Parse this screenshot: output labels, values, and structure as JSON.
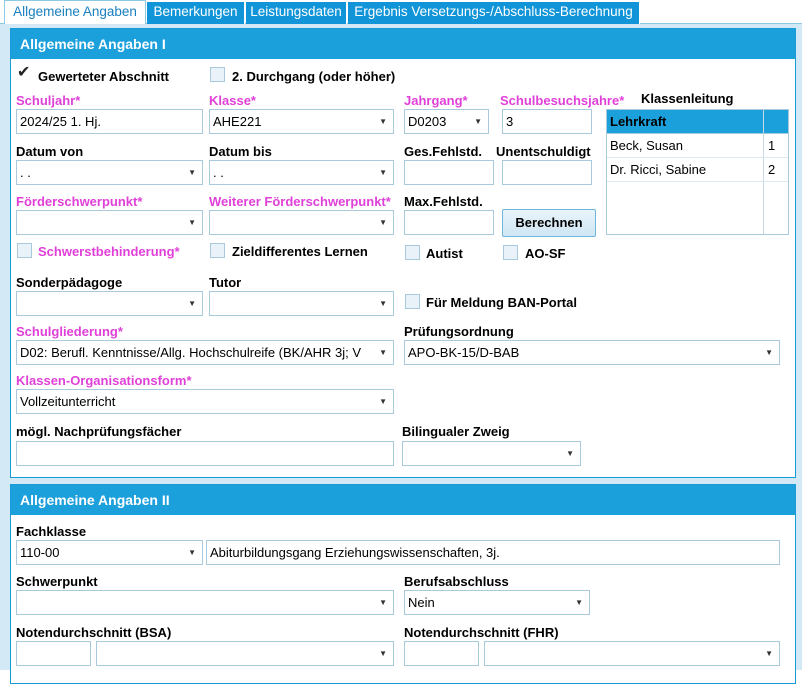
{
  "tabs": [
    "Allgemeine Angaben",
    "Bemerkungen",
    "Leistungsdaten",
    "Ergebnis Versetzungs-/Abschluss-Berechnung"
  ],
  "panel1": {
    "title": "Allgemeine Angaben I",
    "gewerteter_abschnitt": "Gewerteter Abschnitt",
    "durchgang": "2. Durchgang (oder höher)",
    "schuljahr_label": "Schuljahr*",
    "schuljahr_value": "2024/25 1. Hj.",
    "klasse_label": "Klasse*",
    "klasse_value": "AHE221",
    "jahrgang_label": "Jahrgang*",
    "jahrgang_value": "D0203",
    "schulbesuchsjahre_label": "Schulbesuchsjahre*",
    "schulbesuchsjahre_value": "3",
    "klassenleitung_label": "Klassenleitung",
    "klassenleitung_header": "Lehrkraft",
    "klassenleitung_rows": [
      {
        "name": "Beck, Susan",
        "nr": "1"
      },
      {
        "name": "Dr. Ricci, Sabine",
        "nr": "2"
      }
    ],
    "datum_von_label": "Datum von",
    "datum_von_value": " .  .",
    "datum_bis_label": "Datum bis",
    "datum_bis_value": " .  .",
    "ges_fehlstd_label": "Ges.Fehlstd.",
    "unentschuldigt_label": "Unentschuldigt",
    "foerderschwerpunkt_label": "Förderschwerpunkt*",
    "weiterer_foerderschwerpunkt_label": "Weiterer Förderschwerpunkt*",
    "max_fehlstd_label": "Max.Fehlstd.",
    "berechnen_label": "Berechnen",
    "schwerstbehinderung_label": "Schwerstbehinderung*",
    "zieldifferentes_label": "Zieldifferentes Lernen",
    "autist_label": "Autist",
    "aosf_label": "AO-SF",
    "sonderpaedagoge_label": "Sonderpädagoge",
    "tutor_label": "Tutor",
    "ban_portal_label": "Für Meldung BAN-Portal",
    "schulgliederung_label": "Schulgliederung*",
    "schulgliederung_value": "D02: Berufl. Kenntnisse/Allg. Hochschulreife (BK/AHR 3j; V",
    "pruefungsordnung_label": "Prüfungsordnung",
    "pruefungsordnung_value": "APO-BK-15/D-BAB",
    "klassen_org_label": "Klassen-Organisationsform*",
    "klassen_org_value": "Vollzeitunterricht",
    "nachpruefung_label": "mögl. Nachprüfungsfächer",
    "bilingual_label": "Bilingualer Zweig"
  },
  "panel2": {
    "title": "Allgemeine Angaben II",
    "fachklasse_label": "Fachklasse",
    "fachklasse_code": "110-00",
    "fachklasse_text": "Abiturbildungsgang Erziehungswissenschaften, 3j.",
    "schwerpunkt_label": "Schwerpunkt",
    "berufsabschluss_label": "Berufsabschluss",
    "berufsabschluss_value": "Nein",
    "notendurchschnitt_bsa_label": "Notendurchschnitt (BSA)",
    "notendurchschnitt_fhr_label": "Notendurchschnitt (FHR)"
  }
}
